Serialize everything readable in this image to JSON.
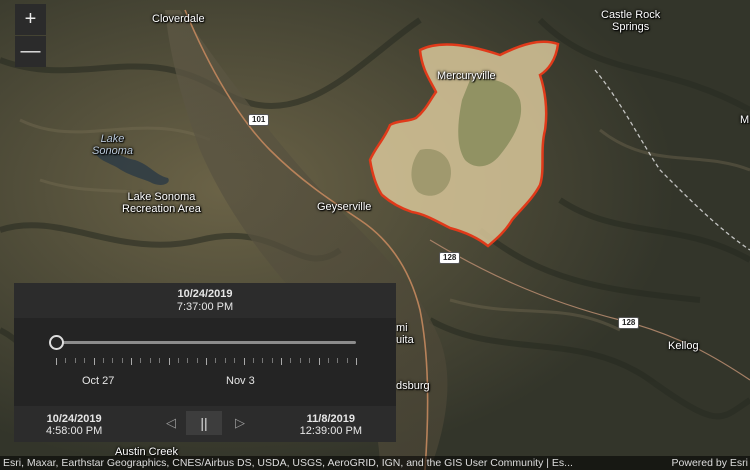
{
  "zoom": {
    "in_label": "+",
    "out_label": "—"
  },
  "places": {
    "cloverdale": "Cloverdale",
    "castle_rock_1": "Castle Rock",
    "castle_rock_2": "Springs",
    "mercuryville": "Mercuryville",
    "lake_sonoma_1": "Lake",
    "lake_sonoma_2": "Sonoma",
    "lsra_1": "Lake Sonoma",
    "lsra_2": "Recreation Area",
    "geyserville": "Geyserville",
    "kellog": "Kellog",
    "healdsburg": "dsburg",
    "alexander": "mi",
    "alexander_2": "uita",
    "austin_creek": "Austin Creek",
    "m_edge": "M"
  },
  "shields": {
    "us101": "101",
    "ca128_a": "128",
    "ca128_b": "128"
  },
  "time_slider": {
    "current_date": "10/24/2019",
    "current_time": "7:37:00 PM",
    "tick_label_1": "Oct 27",
    "tick_label_2": "Nov 3",
    "start_date": "10/24/2019",
    "start_time": "4:58:00 PM",
    "end_date": "11/8/2019",
    "end_time": "12:39:00 PM",
    "prev_icon": "◁",
    "play_icon": "||",
    "next_icon": "▷",
    "progress": 0.0
  },
  "attribution": {
    "text": "Esri, Maxar, Earthstar Geographics, CNES/Airbus DS, USDA, USGS, AeroGRID, IGN, and the GIS User Community | Es...",
    "powered": "Powered by Esri"
  },
  "colors": {
    "fire_fill": "#d8c79a",
    "fire_edge": "#e03a1a",
    "terrain_dark": "#2f3326",
    "terrain_light": "#6b6347"
  }
}
